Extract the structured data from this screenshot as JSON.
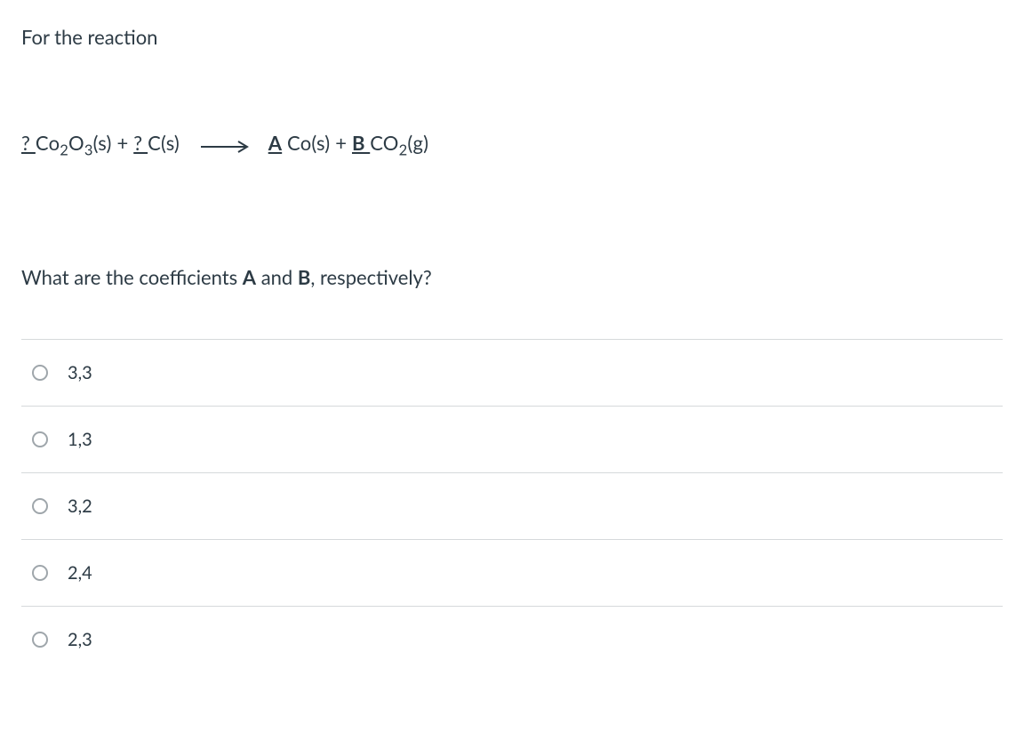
{
  "intro": "For the reaction",
  "equation": {
    "coef1": "? ",
    "species1_base": "Co",
    "species1_sub1": "2",
    "species1_mid": "O",
    "species1_sub2": "3",
    "species1_state": "(s)",
    "plus1": "  +  ",
    "coef2": "? ",
    "species2": "C(s)",
    "coefA": "A",
    "species3": " Co(s)",
    "plus2": "  +   ",
    "coefB": "B ",
    "species4_base": "CO",
    "species4_sub": "2",
    "species4_state": "(g)"
  },
  "prompt": {
    "pre": "What are the coefficients ",
    "a": "A",
    "mid": " and ",
    "b": "B",
    "post": ", respectively?"
  },
  "options": {
    "o1": "3,3",
    "o2": "1,3",
    "o3": "3,2",
    "o4": "2,4",
    "o5": "2,3"
  }
}
